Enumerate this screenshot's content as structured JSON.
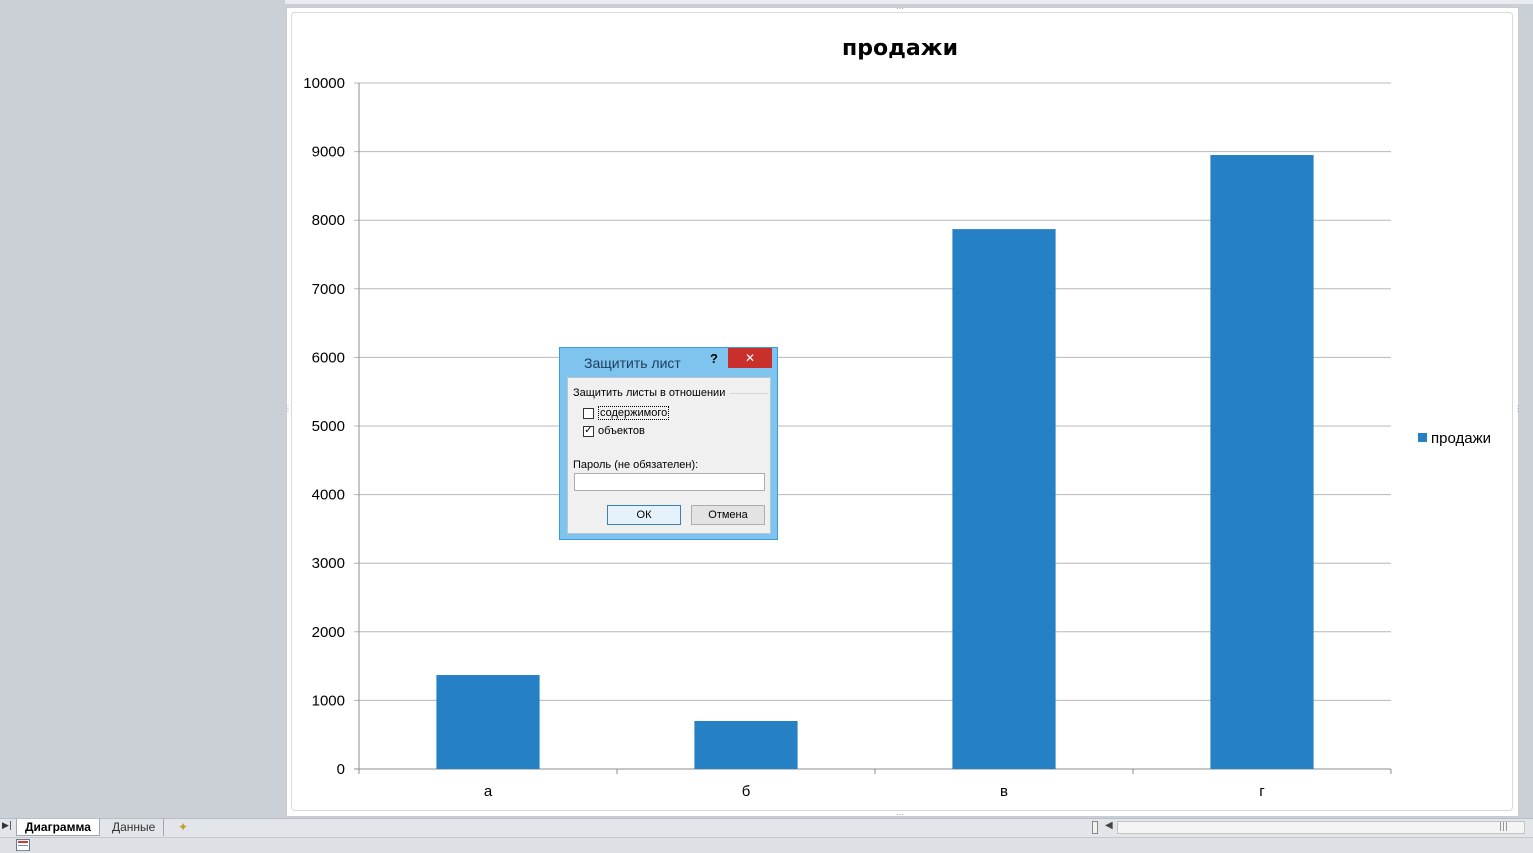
{
  "chart_data": {
    "type": "bar",
    "title": "продажи",
    "categories": [
      "а",
      "б",
      "в",
      "г"
    ],
    "series": [
      {
        "name": "продажи",
        "values": [
          1370,
          700,
          7870,
          8950
        ]
      }
    ],
    "ylim": [
      0,
      10000
    ],
    "yticks": [
      0,
      1000,
      2000,
      3000,
      4000,
      5000,
      6000,
      7000,
      8000,
      9000,
      10000
    ],
    "grid": true,
    "legend": "right",
    "bar_color": "#2581c4"
  },
  "dialog": {
    "title": "Защитить лист",
    "help": "?",
    "close": "✕",
    "group_label": "Защитить листы в отношении",
    "opt_contents": "содержимого",
    "opt_contents_checked": "",
    "opt_objects": "объектов",
    "opt_objects_checked": "✓",
    "password_label": "Пароль (не обязателен):",
    "password_value": "",
    "ok": "ОК",
    "cancel": "Отмена"
  },
  "sheet_tabs": {
    "nav": "▶|",
    "tabs": [
      "Диаграмма",
      "Данные"
    ],
    "new_sheet": "✦"
  },
  "colors": {
    "accent": "#2581c4",
    "dialog_frame": "#7fc4ee",
    "close_button": "#c9302c"
  }
}
